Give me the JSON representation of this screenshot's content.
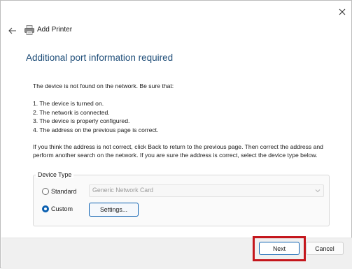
{
  "window": {
    "close_icon": "close-icon",
    "back_icon": "back-arrow-icon",
    "printer_icon": "printer-icon",
    "title": "Add Printer"
  },
  "page": {
    "heading": "Additional port information required",
    "intro": "The device is not found on the network.  Be sure that:",
    "checklist": [
      "1.  The device is turned on.",
      "2.  The network is connected.",
      "3.  The device is properly configured.",
      "4.  The address on the previous page is correct."
    ],
    "explanation": "If you think the address is not correct, click Back to return to the previous page.  Then correct the address and perform another search on the network.  If you are sure the address is correct, select the device type below."
  },
  "device_type": {
    "label": "Device Type",
    "standard_label": "Standard",
    "standard_selected": false,
    "standard_value": "Generic Network Card",
    "custom_label": "Custom",
    "custom_selected": true,
    "settings_label": "Settings..."
  },
  "footer": {
    "next_label": "Next",
    "cancel_label": "Cancel",
    "highlight_color": "#c4161c",
    "accent_color": "#0a5fb0"
  }
}
